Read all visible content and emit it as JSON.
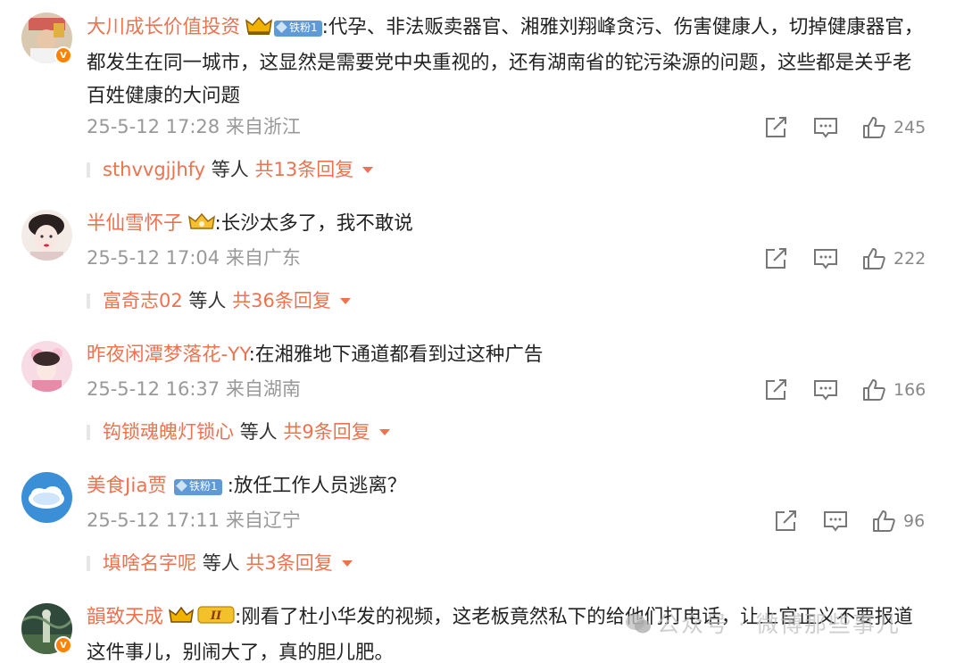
{
  "colors": {
    "username": "#eb7350",
    "timestamp": "#999999",
    "badge_fan": "#5f9ad6",
    "vip_badge": "#ff8200"
  },
  "comments": [
    {
      "username": "大川成长价值投资",
      "badges": [
        "crown-icon",
        "铁粉1"
      ],
      "text": ":代孕、非法贩卖器官、湘雅刘翔峰贪污、伤害健康人，切掉健康器官，都发生在同一城市，这显然是需要党中央重视的，还有湖南省的铊污染源的问题，这些都是关乎老百姓健康的大问题",
      "time": "25-5-12 17:28 来自浙江",
      "likes": "245",
      "reply_user": "sthvvgjjhfy",
      "reply_etc": "等人",
      "reply_count": "共13条回复"
    },
    {
      "username": "半仙雪怀子",
      "badges": [
        "crown-icon"
      ],
      "text": ":长沙太多了，我不敢说",
      "time": "25-5-12 17:04 来自广东",
      "likes": "222",
      "reply_user": "富奇志02",
      "reply_etc": "等人",
      "reply_count": "共36条回复"
    },
    {
      "username": "昨夜闲潭梦落花-YY",
      "badges": [],
      "text": ":在湘雅地下通道都看到过这种广告",
      "time": "25-5-12 16:37 来自湖南",
      "likes": "166",
      "reply_user": "钩锁魂魄灯锁心",
      "reply_etc": "等人",
      "reply_count": "共9条回复"
    },
    {
      "username": "美食Jia贾",
      "badges": [
        "铁粉1"
      ],
      "text": ":放任工作人员逃离？",
      "time": "25-5-12 17:11 来自辽宁",
      "likes": "96",
      "reply_user": "填啥名字呢",
      "reply_etc": "等人",
      "reply_count": "共3条回复"
    },
    {
      "username": "韻致天成",
      "badges": [
        "crown-icon",
        "II"
      ],
      "text": ":刚看了杜小华发的视频，这老板竟然私下的给他们打电话，让上官正义不要报道这件事儿，别闹大了，真的胆儿肥。"
    }
  ],
  "watermark": "公众号 · 微博那些事儿"
}
